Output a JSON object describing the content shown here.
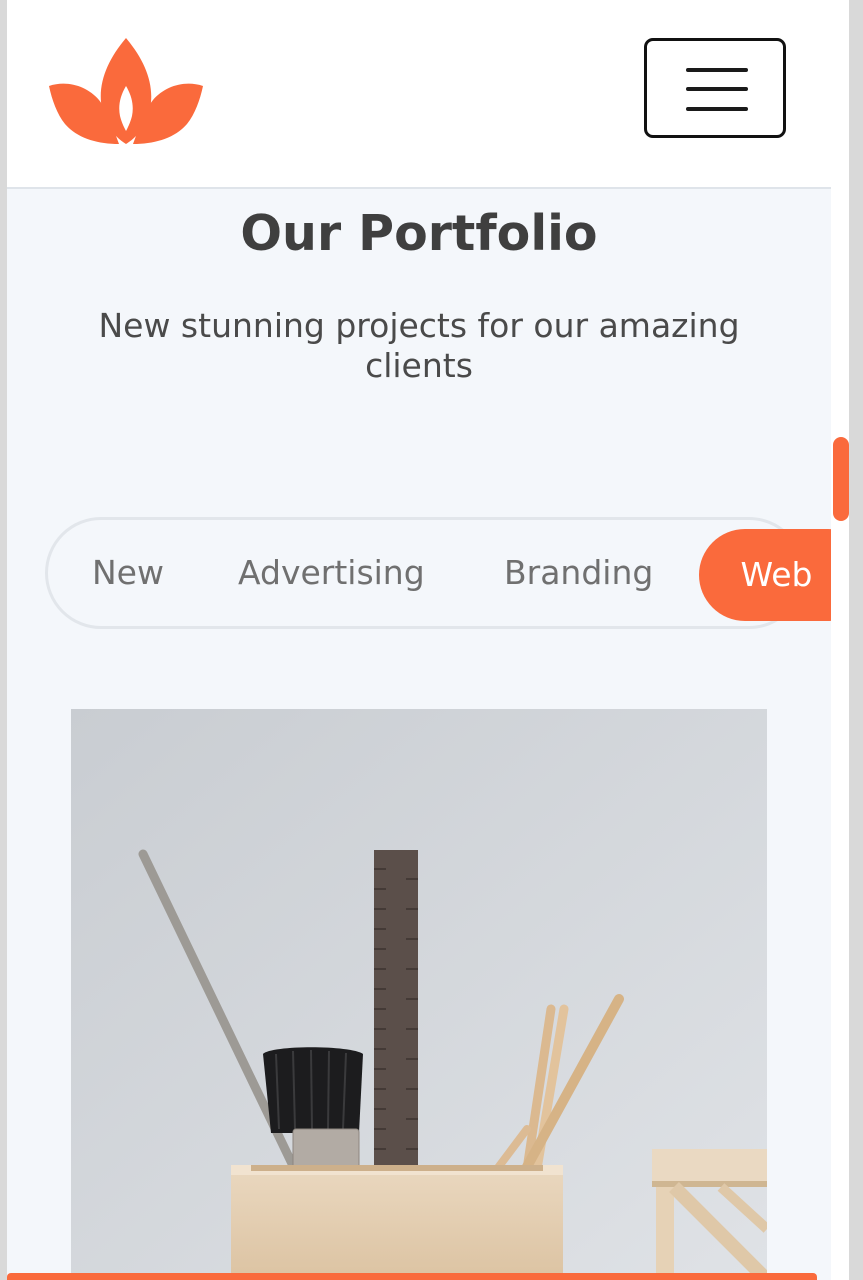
{
  "header": {
    "logo_icon": "lotus-logo",
    "menu_icon": "hamburger-menu-icon"
  },
  "portfolio": {
    "title": "Our Portfolio",
    "subtitle": "New stunning projects for our amazing clients"
  },
  "tabs": [
    {
      "label": "New",
      "active": false
    },
    {
      "label": "Advertising",
      "active": false
    },
    {
      "label": "Branding",
      "active": false
    },
    {
      "label": "Web",
      "active": true
    }
  ],
  "colors": {
    "accent": "#fa6a3c",
    "background": "#f4f7fb",
    "title": "#3f3f3f"
  }
}
